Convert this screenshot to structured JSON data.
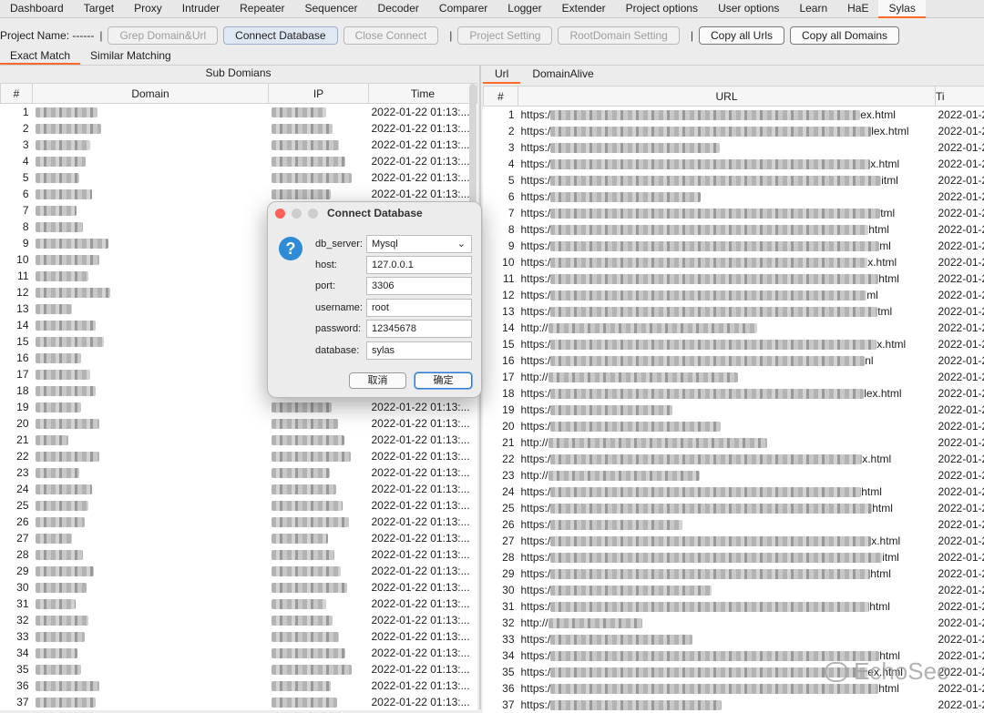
{
  "tabs": [
    "Dashboard",
    "Target",
    "Proxy",
    "Intruder",
    "Repeater",
    "Sequencer",
    "Decoder",
    "Comparer",
    "Logger",
    "Extender",
    "Project options",
    "User options",
    "Learn",
    "HaE",
    "Sylas"
  ],
  "toolbar": {
    "project_name_label": "Project Name: ------",
    "sep": "|",
    "grep_label": "Grep Domain&Url",
    "connect_label": "Connect Database",
    "close_label": "Close Connect",
    "project_setting_label": "Project Setting",
    "rootdomain_label": "RootDomain Setting",
    "copy_urls_label": "Copy all Urls",
    "copy_domains_label": "Copy all Domains"
  },
  "subtabs": [
    "Exact Match",
    "Similar Matching"
  ],
  "left": {
    "title": "Sub Domians",
    "headers": [
      "#",
      "Domain",
      "IP",
      "Time"
    ],
    "time_value": "2022-01-22 01:13:...",
    "row_count": 37
  },
  "right": {
    "tabs": [
      "Url",
      "DomainAlive"
    ],
    "headers": [
      "#",
      "URL",
      "Ti"
    ],
    "url_prefixes": [
      "https:/",
      "https:/",
      "https:/",
      "https:/",
      "https:/",
      "https:/",
      "https:/",
      "https:/",
      "https:/",
      "https:/",
      "https:/",
      "https:/",
      "https:/",
      "http://",
      "https:/",
      "https:/",
      "http://",
      "https:/",
      "https:/",
      "https:/",
      "http://",
      "https:/",
      "http://",
      "https:/",
      "https:/",
      "https:/",
      "https:/",
      "https:/",
      "https:/",
      "https:/",
      "https:/",
      "http://",
      "https:/",
      "https:/",
      "https:/",
      "https:/",
      "https:/"
    ],
    "url_suffixes": [
      "ex.html",
      "lex.html",
      "",
      "x.html",
      "itml",
      "",
      "tml",
      "html",
      "ml",
      "x.html",
      "html",
      "ml",
      "tml",
      "",
      "x.html",
      "nl",
      "",
      "lex.html",
      "",
      "",
      "",
      "x.html",
      "",
      "html",
      "html",
      "",
      "x.html",
      "itml",
      "html",
      "",
      "html",
      "",
      "",
      "html",
      "ex.html",
      "html",
      ""
    ],
    "time_value": "2022-01-2"
  },
  "dialog": {
    "title": "Connect Database",
    "fields": [
      {
        "label": "db_server:",
        "value": "Mysql"
      },
      {
        "label": "host:",
        "value": "127.0.0.1"
      },
      {
        "label": "port:",
        "value": "3306"
      },
      {
        "label": "username:",
        "value": "root"
      },
      {
        "label": "password:",
        "value": "12345678"
      },
      {
        "label": "database:",
        "value": "sylas"
      }
    ],
    "cancel": "取消",
    "ok": "确定"
  },
  "watermark": "EchoSec",
  "colors": {
    "accent": "#ff6a2a",
    "close_dot": "#fe5f57",
    "question_icon": "#2f8bd6"
  }
}
